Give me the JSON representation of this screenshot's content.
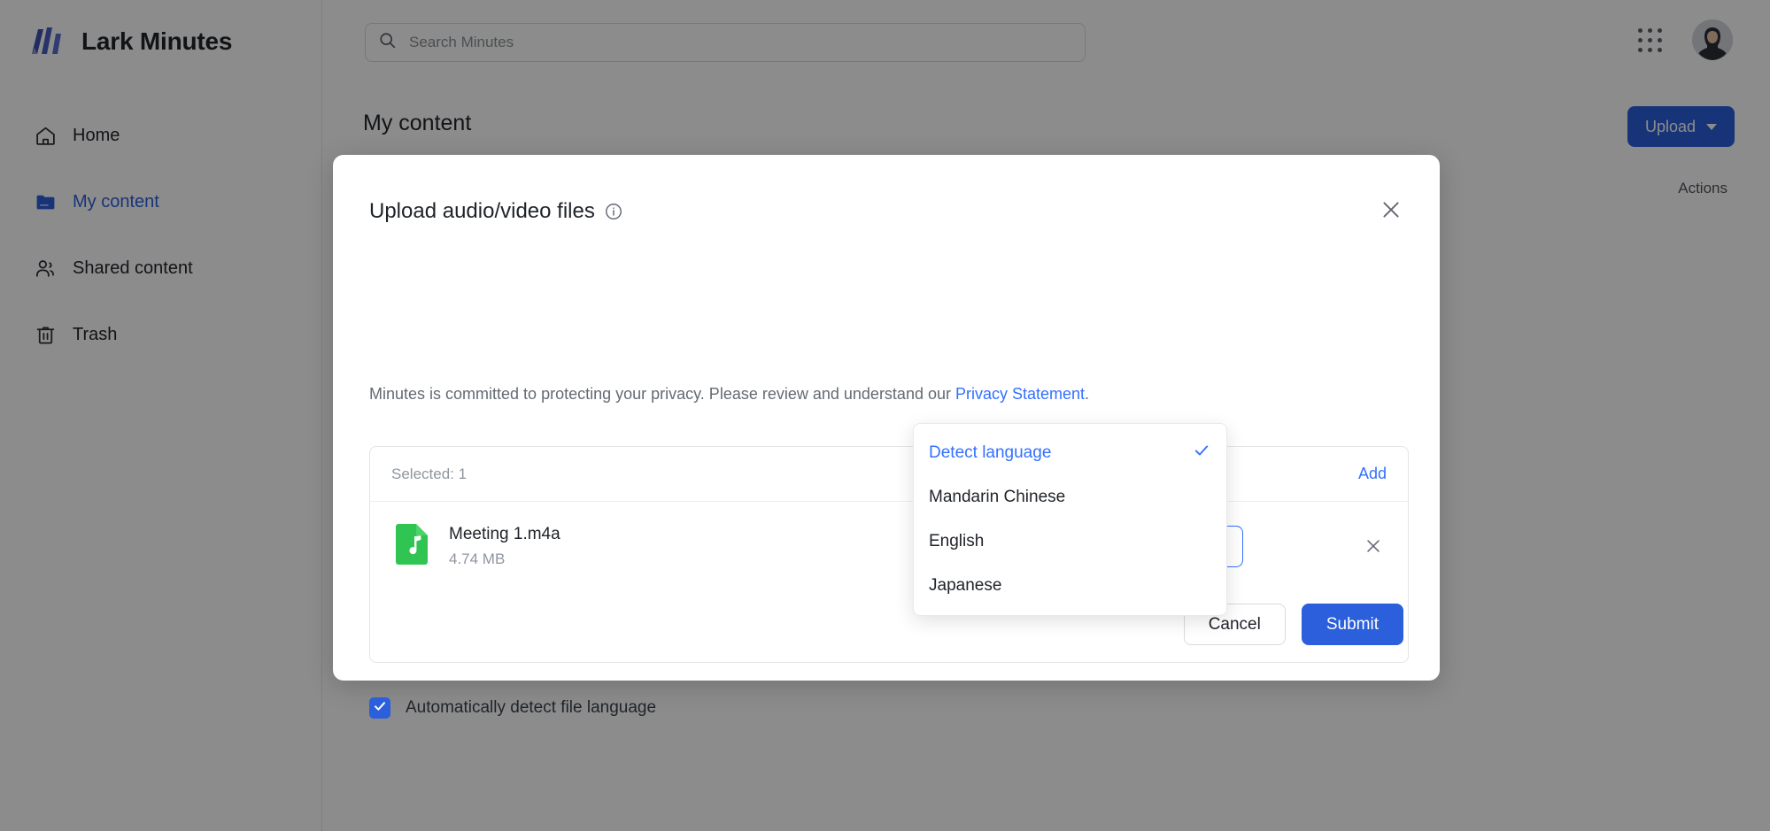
{
  "app": {
    "brand_name": "Lark Minutes",
    "logo_icon": "lark-minutes-logo"
  },
  "sidebar": {
    "items": [
      {
        "label": "Home",
        "icon": "home-icon",
        "active": false
      },
      {
        "label": "My content",
        "icon": "folder-icon",
        "active": true
      },
      {
        "label": "Shared content",
        "icon": "people-icon",
        "active": false
      },
      {
        "label": "Trash",
        "icon": "trash-icon",
        "active": false
      }
    ]
  },
  "header": {
    "search_placeholder": "Search Minutes",
    "search_value": "",
    "search_icon": "search-icon",
    "apps_icon": "grid-apps-icon",
    "avatar_icon": "user-avatar"
  },
  "main": {
    "page_title": "My content",
    "upload_label": "Upload",
    "upload_caret_icon": "chevron-down-icon",
    "actions_label": "Actions"
  },
  "modal": {
    "title": "Upload audio/video files",
    "info_icon": "info-circle-icon",
    "close_icon": "close-icon",
    "subtitle_prefix": "Minutes is committed to protecting your privacy. Please review and understand our ",
    "privacy_link": "Privacy Statement",
    "subtitle_suffix": ".",
    "selected_count": "Selected: 1",
    "add_label": "Add",
    "file": {
      "icon": "audio-file-icon",
      "name": "Meeting 1.m4a",
      "size": "4.74 MB",
      "remove_icon": "close-icon"
    },
    "language_select": {
      "value": "Detect language",
      "caret_icon": "chevron-up-icon",
      "expanded": true,
      "options": [
        {
          "label": "Detect language",
          "selected": true
        },
        {
          "label": "Mandarin Chinese",
          "selected": false
        },
        {
          "label": "English",
          "selected": false
        },
        {
          "label": "Japanese",
          "selected": false
        }
      ]
    },
    "auto_detect": {
      "label": "Automatically detect file language",
      "checked": true,
      "check_icon": "checkmark-icon"
    },
    "cancel_label": "Cancel",
    "submit_label": "Submit"
  },
  "colors": {
    "accent_blue": "#2b5fdb",
    "link_blue": "#3370ff",
    "file_green": "#30c453",
    "text_primary": "#1f2329",
    "text_muted": "#8f959e"
  }
}
